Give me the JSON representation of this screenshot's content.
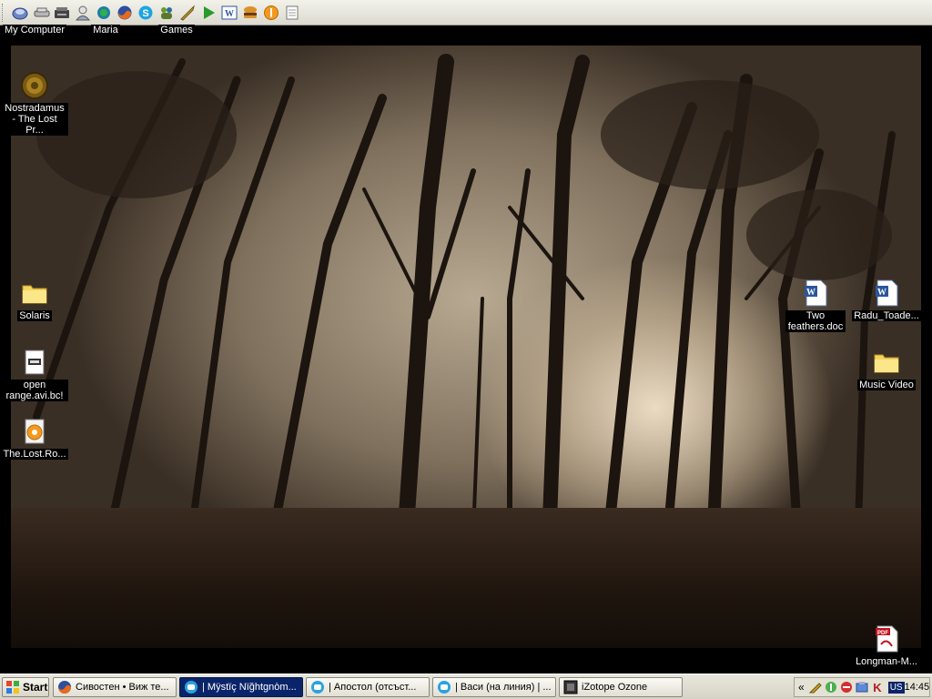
{
  "quick_launch": {
    "icons": [
      "show-desktop-icon",
      "network-drive-icon",
      "scanner-icon",
      "user-icon",
      "internet-explorer-icon",
      "firefox-icon",
      "skype-icon",
      "messenger-icon",
      "sword-icon",
      "play-icon",
      "word-icon",
      "hamburger-icon",
      "orange-ball-icon",
      "notepad-icon"
    ]
  },
  "desktop": {
    "left_icons": [
      {
        "label": "My Computer",
        "icon": "my-computer-icon"
      },
      {
        "label": "Maria",
        "icon": "folder-icon"
      },
      {
        "label": "Games",
        "icon": "folder-icon"
      },
      {
        "label": "Nostradamus - The Lost Pr...",
        "icon": "coin-icon"
      },
      {
        "label": "Solaris",
        "icon": "folder-icon"
      },
      {
        "label": "open range.avi.bc!",
        "icon": "file-icon"
      },
      {
        "label": "The.Lost.Ro...",
        "icon": "media-file-icon"
      }
    ],
    "right_icons": [
      {
        "label": "Two feathers.doc",
        "icon": "word-doc-icon"
      },
      {
        "label": "Radu_Toade...",
        "icon": "word-doc-icon"
      },
      {
        "label": "Music Video",
        "icon": "folder-icon"
      },
      {
        "label": "Longman-M...",
        "icon": "pdf-icon"
      }
    ]
  },
  "taskbar": {
    "start_label": "Start",
    "buttons": [
      {
        "label": "Сивостен • Виж те...",
        "icon": "firefox-icon",
        "active": false
      },
      {
        "label": "| Mÿstïç Nïğhtgnòm...",
        "icon": "skype-chat-icon",
        "active": true
      },
      {
        "label": "| Апостол (отсъст...",
        "icon": "skype-chat-icon",
        "active": false
      },
      {
        "label": "| Васи (на линия) | ...",
        "icon": "skype-chat-icon",
        "active": false
      },
      {
        "label": "iZotope Ozone",
        "icon": "izotope-icon",
        "active": false
      }
    ],
    "tray": {
      "expand_label": "«",
      "icons": [
        "tool-icon",
        "network-icon",
        "skype-status-icon",
        "security-icon",
        "kaspersky-icon"
      ],
      "language": "US",
      "clock": "14:45"
    }
  },
  "colors": {
    "taskbar_active": "#0a246a",
    "taskbar_bg": "#e0ded2",
    "label_bg": "#000000"
  }
}
